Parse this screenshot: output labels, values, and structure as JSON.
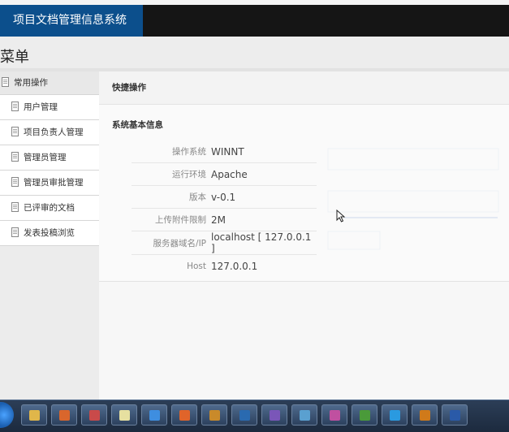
{
  "header": {
    "title": "项目文档管理信息系统"
  },
  "menu": {
    "title": "菜单"
  },
  "sidebar": {
    "group": "常用操作",
    "items": [
      {
        "label": "用户管理"
      },
      {
        "label": "项目负责人管理"
      },
      {
        "label": "管理员管理"
      },
      {
        "label": "管理员审批管理"
      },
      {
        "label": "已评审的文档"
      },
      {
        "label": "发表投稿浏览"
      }
    ]
  },
  "main": {
    "quick_ops": "快捷操作",
    "system_info": {
      "title": "系统基本信息",
      "rows": [
        {
          "label": "操作系统",
          "value": "WINNT"
        },
        {
          "label": "运行环境",
          "value": "Apache"
        },
        {
          "label": "版本",
          "value": "v-0.1"
        },
        {
          "label": "上传附件限制",
          "value": "2M"
        },
        {
          "label": "服务器域名/IP",
          "value": "localhost [ 127.0.0.1 ]"
        },
        {
          "label": "Host",
          "value": "127.0.0.1"
        }
      ]
    }
  },
  "taskbar": {
    "apps": [
      {
        "icon": "folder-icon",
        "color": "#e0b64a"
      },
      {
        "icon": "media-icon",
        "color": "#d9662c"
      },
      {
        "icon": "paint-icon",
        "color": "#c94a4a"
      },
      {
        "icon": "notepad-icon",
        "color": "#e6e0a0"
      },
      {
        "icon": "ie-icon",
        "color": "#3e8ee0"
      },
      {
        "icon": "firefox-icon",
        "color": "#e0642a"
      },
      {
        "icon": "book-icon",
        "color": "#c98a2a"
      },
      {
        "icon": "editor-icon",
        "color": "#2a6ab0"
      },
      {
        "icon": "visual-studio-icon",
        "color": "#7a56b8"
      },
      {
        "icon": "window-icon",
        "color": "#5aa0d0"
      },
      {
        "icon": "palette-icon",
        "color": "#c050a0"
      },
      {
        "icon": "chrome-icon",
        "color": "#4a9a3a"
      },
      {
        "icon": "skype-icon",
        "color": "#2a9ae0"
      },
      {
        "icon": "apache-icon",
        "color": "#d07a1a"
      },
      {
        "icon": "word-icon",
        "color": "#2a5aa8"
      }
    ]
  }
}
